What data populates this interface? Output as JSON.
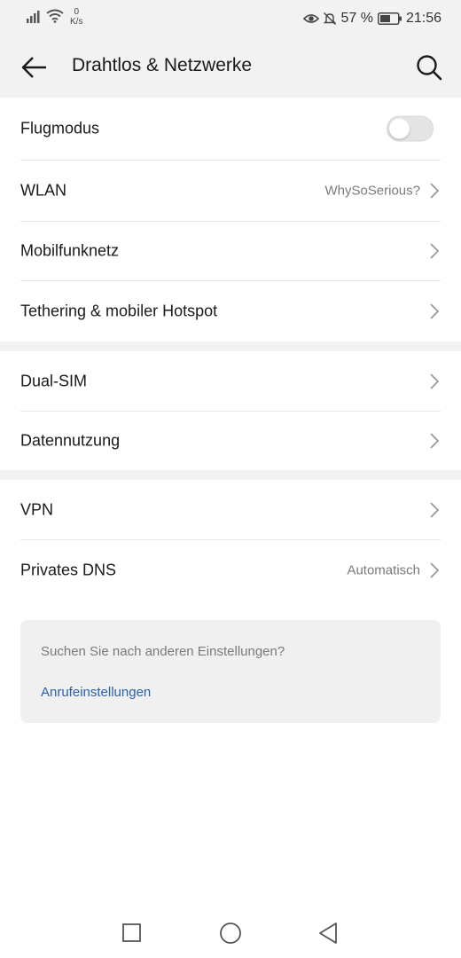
{
  "status_bar": {
    "net_speed_value": "0",
    "net_speed_unit": "K/s",
    "battery_percent": "57 %",
    "time": "21:56"
  },
  "header": {
    "title": "Drahtlos & Netzwerke",
    "back_icon": "arrow-left-icon",
    "search_icon": "search-icon"
  },
  "settings": {
    "group1": [
      {
        "label": "Flugmodus",
        "type": "toggle",
        "enabled": false
      },
      {
        "label": "WLAN",
        "value": "WhySoSerious?"
      },
      {
        "label": "Mobilfunknetz",
        "value": ""
      },
      {
        "label": "Tethering & mobiler Hotspot",
        "value": ""
      }
    ],
    "group2": [
      {
        "label": "Dual-SIM",
        "value": ""
      },
      {
        "label": "Datennutzung",
        "value": ""
      }
    ],
    "group3": [
      {
        "label": "VPN",
        "value": ""
      },
      {
        "label": "Privates DNS",
        "value": "Automatisch"
      }
    ]
  },
  "suggestions": {
    "question": "Suchen Sie nach anderen Einstellungen?",
    "link": "Anrufeinstellungen"
  },
  "colors": {
    "header_bg": "#f2f2f2",
    "link": "#2a62a8",
    "secondary_text": "#7a7a7a"
  }
}
